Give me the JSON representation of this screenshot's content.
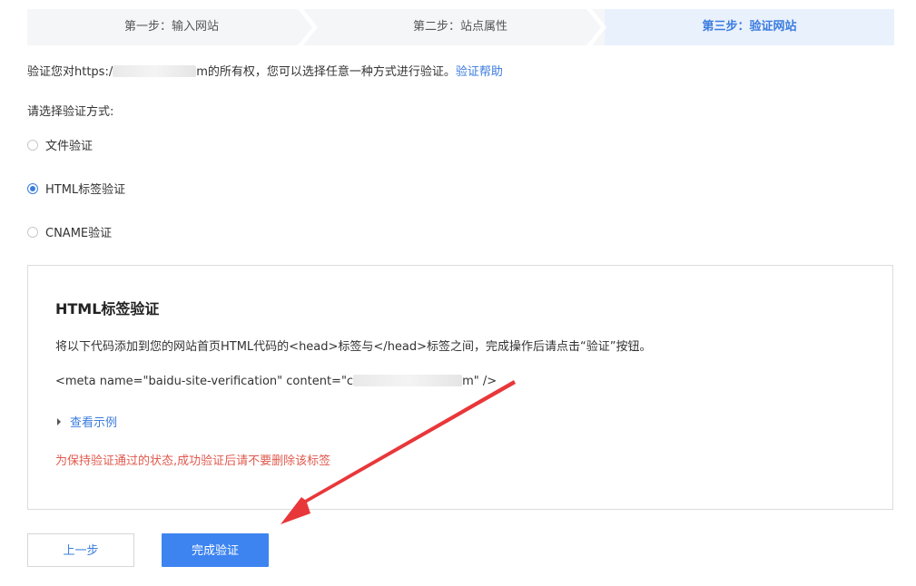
{
  "steps": [
    {
      "label": "第一步：输入网站",
      "active": false
    },
    {
      "label": "第二步：站点属性",
      "active": false
    },
    {
      "label": "第三步：验证网站",
      "active": true
    }
  ],
  "intro": {
    "prefix": "验证您对https:/",
    "suffix": "m的所有权，您可以选择任意一种方式进行验证。",
    "help_link": "验证帮助"
  },
  "method_prompt": "请选择验证方式:",
  "methods": [
    {
      "label": "文件验证",
      "checked": false
    },
    {
      "label": "HTML标签验证",
      "checked": true
    },
    {
      "label": "CNAME验证",
      "checked": false
    }
  ],
  "panel": {
    "title": "HTML标签验证",
    "description": "将以下代码添加到您的网站首页HTML代码的<head>标签与</head>标签之间，完成操作后请点击“验证”按钮。",
    "code_prefix": "<meta name=\"baidu-site-verification\" content=\"c",
    "code_suffix": "m\" />",
    "example_link": "查看示例",
    "warning": "为保持验证通过的状态,成功验证后请不要删除该标签"
  },
  "buttons": {
    "prev": "上一步",
    "done": "完成验证"
  },
  "colors": {
    "accent": "#3b7cde",
    "primary_button": "#3d84f0",
    "warning": "#e05a4e",
    "annotation_arrow": "#e8373a"
  }
}
